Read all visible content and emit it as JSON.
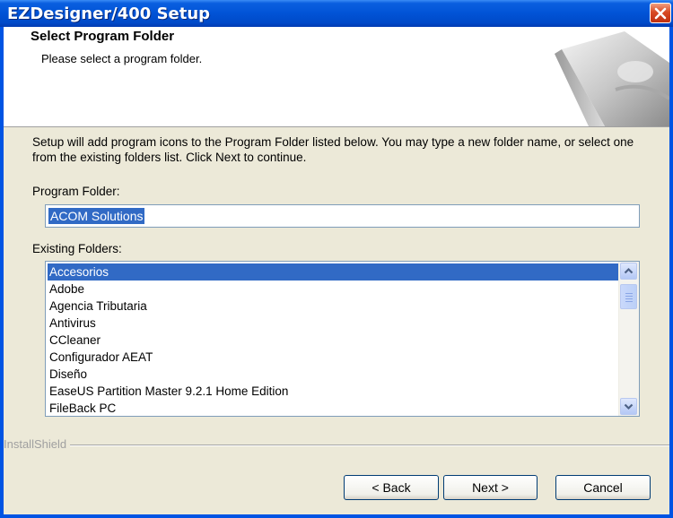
{
  "window": {
    "title": "EZDesigner/400 Setup"
  },
  "header": {
    "title": "Select Program Folder",
    "subtitle": "Please select a program folder."
  },
  "intro_text": "Setup will add program icons to the Program Folder listed below.  You may type a new folder name, or select one from the existing folders list.  Click Next to continue.",
  "program_folder": {
    "label": "Program Folder:",
    "value": "ACOM Solutions"
  },
  "existing_folders": {
    "label": "Existing Folders:",
    "items": [
      "Accesorios",
      "Adobe",
      "Agencia Tributaria",
      "Antivirus",
      "CCleaner",
      "Configurador AEAT",
      "Diseño",
      "EaseUS Partition Master 9.2.1 Home Edition",
      "FileBack PC"
    ],
    "selected_index": 0
  },
  "brand": "InstallShield",
  "buttons": {
    "back": "< Back",
    "next": "Next >",
    "cancel": "Cancel"
  },
  "icons": {
    "close": "close-icon",
    "scroll_up": "chevron-up-icon",
    "scroll_down": "chevron-down-icon"
  },
  "colors": {
    "title_bar": "#0054e3",
    "selection": "#316ac5",
    "dialog_bg": "#ece9d8"
  }
}
